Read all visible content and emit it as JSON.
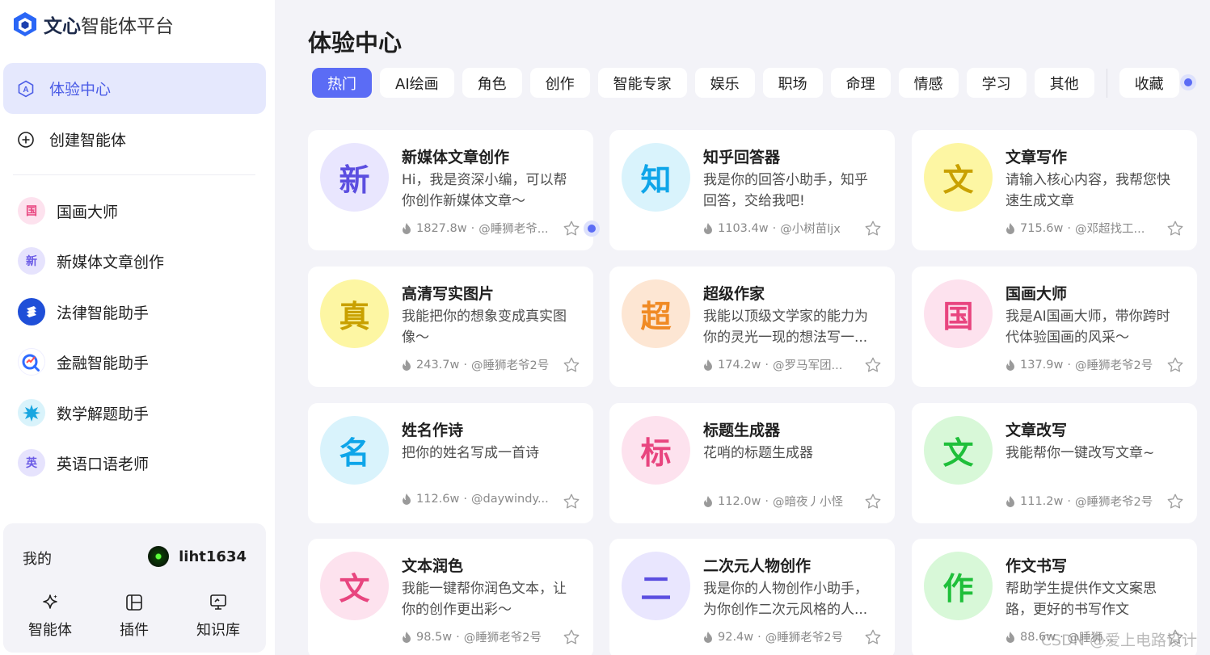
{
  "app": {
    "logo_bold": "文心",
    "logo_rest": "智能体平台"
  },
  "nav": [
    {
      "label": "体验中心",
      "icon": "experience-center-icon",
      "active": true
    },
    {
      "label": "创建智能体",
      "icon": "plus-circle-icon",
      "active": false
    }
  ],
  "recent_agents": [
    {
      "label": "国画大师",
      "avatar": "国",
      "bg": "#fde2ee",
      "fg": "#e8457f"
    },
    {
      "label": "新媒体文章创作",
      "avatar": "新",
      "bg": "#e6e3fd",
      "fg": "#6b5be6"
    },
    {
      "label": "法律智能助手",
      "avatar": "",
      "bg": "#1f4fd8",
      "fg": "#ffffff"
    },
    {
      "label": "金融智能助手",
      "avatar": "",
      "bg": "#ffffff",
      "fg": "#2f6bff"
    },
    {
      "label": "数学解题助手",
      "avatar": "",
      "bg": "#d9f3fb",
      "fg": "#19a6e0"
    },
    {
      "label": "英语口语老师",
      "avatar": "英",
      "bg": "#e6e3fd",
      "fg": "#6b5be6"
    }
  ],
  "mine": {
    "title": "我的",
    "username": "liht1634",
    "tools": [
      {
        "label": "智能体",
        "icon": "sparkle-icon"
      },
      {
        "label": "插件",
        "icon": "plugin-icon"
      },
      {
        "label": "知识库",
        "icon": "knowledge-base-icon"
      }
    ]
  },
  "main": {
    "title": "体验中心",
    "tabs": [
      {
        "label": "热门",
        "active": true
      },
      {
        "label": "AI绘画"
      },
      {
        "label": "角色"
      },
      {
        "label": "创作"
      },
      {
        "label": "智能专家"
      },
      {
        "label": "娱乐"
      },
      {
        "label": "职场"
      },
      {
        "label": "命理"
      },
      {
        "label": "情感"
      },
      {
        "label": "学习"
      },
      {
        "label": "其他"
      }
    ],
    "favorites_tab": "收藏"
  },
  "cards": [
    {
      "avatar": "新",
      "bg": "#e9e6fe",
      "fg": "#5b4ee0",
      "title": "新媒体文章创作",
      "desc": "Hi，我是资深小编，可以帮你创作新媒体文章～",
      "hot": "1827.8w",
      "author": "@睡狮老爷..."
    },
    {
      "avatar": "知",
      "bg": "#d9f3fc",
      "fg": "#0ea5e9",
      "title": "知乎回答器",
      "desc": "我是你的回答小助手，知乎回答，交给我吧!",
      "hot": "1103.4w",
      "author": "@小树苗ljx"
    },
    {
      "avatar": "文",
      "bg": "#fdf6a3",
      "fg": "#c9a100",
      "title": "文章写作",
      "desc": "请输入核心内容，我帮您快速生成文章",
      "hot": "715.6w",
      "author": "@邓超找工..."
    },
    {
      "avatar": "真",
      "bg": "#fdf6a3",
      "fg": "#c9a100",
      "title": "高清写实图片",
      "desc": "我能把你的想象变成真实图像～",
      "hot": "243.7w",
      "author": "@睡狮老爷2号"
    },
    {
      "avatar": "超",
      "bg": "#fde6d3",
      "fg": "#f08a24",
      "title": "超级作家",
      "desc": "我能以顶级文学家的能力为你的灵光一现的想法写一...",
      "hot": "174.2w",
      "author": "@罗马军团..."
    },
    {
      "avatar": "国",
      "bg": "#fde2ee",
      "fg": "#e8457f",
      "title": "国画大师",
      "desc": "我是AI国画大师，带你跨时代体验国画的风采～",
      "hot": "137.9w",
      "author": "@睡狮老爷2号"
    },
    {
      "avatar": "名",
      "bg": "#d9f3fc",
      "fg": "#0ea5e9",
      "title": "姓名作诗",
      "desc": "把你的姓名写成一首诗",
      "hot": "112.6w",
      "author": "@daywindy..."
    },
    {
      "avatar": "标",
      "bg": "#fde2ee",
      "fg": "#e8457f",
      "title": "标题生成器",
      "desc": "花哨的标题生成器",
      "hot": "112.0w",
      "author": "@暗夜丿小怪"
    },
    {
      "avatar": "文",
      "bg": "#d8f8d8",
      "fg": "#1fbf3a",
      "title": "文章改写",
      "desc": "我能帮你一键改写文章~",
      "hot": "111.2w",
      "author": "@睡狮老爷2号"
    },
    {
      "avatar": "文",
      "bg": "#fde2ee",
      "fg": "#e8457f",
      "title": "文本润色",
      "desc": "我能一键帮你润色文本，让你的创作更出彩～",
      "hot": "98.5w",
      "author": "@睡狮老爷2号"
    },
    {
      "avatar": "二",
      "bg": "#e9e6fe",
      "fg": "#5b4ee0",
      "title": "二次元人物创作",
      "desc": "我是你的人物创作小助手，为你创作二次元风格的人...",
      "hot": "92.4w",
      "author": "@睡狮老爷2号"
    },
    {
      "avatar": "作",
      "bg": "#d8f8d8",
      "fg": "#1fbf3a",
      "title": "作文书写",
      "desc": "帮助学生提供作文文案思路，更好的书写作文",
      "hot": "88.6w",
      "author": "@睡狮..."
    }
  ],
  "watermark": "CSDN @爱上电路设计"
}
